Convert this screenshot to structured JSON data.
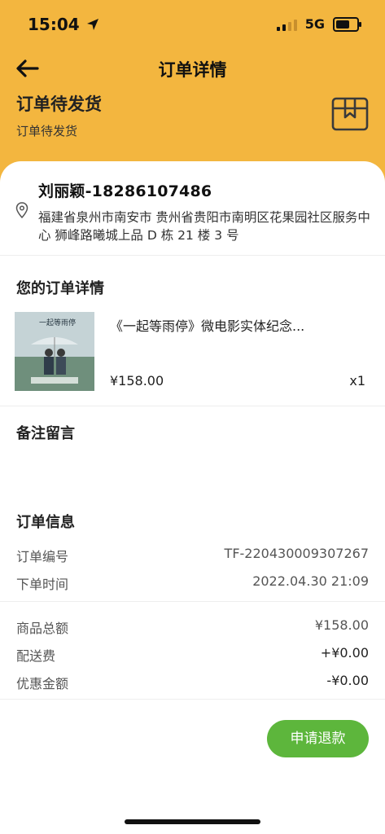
{
  "status_bar": {
    "time": "15:04",
    "network": "5G"
  },
  "header": {
    "title": "订单详情",
    "status_title": "订单待发货",
    "status_subtitle": "订单待发货"
  },
  "address": {
    "name_phone": "刘丽颖-18286107486",
    "detail": "福建省泉州市南安市 贵州省贵阳市南明区花果园社区服务中心 狮峰路曦城上品 D 栋 21 楼 3 号"
  },
  "order_items": {
    "title": "您的订单详情",
    "items": [
      {
        "name": "《一起等雨停》微电影实体纪念...",
        "price": "¥158.00",
        "quantity": "x1"
      }
    ]
  },
  "remark": {
    "title": "备注留言"
  },
  "order_info": {
    "title": "订单信息",
    "order_no_label": "订单编号",
    "order_no": "TF-220430009307267",
    "order_time_label": "下单时间",
    "order_time": "2022.04.30 21:09"
  },
  "amounts": {
    "goods_total_label": "商品总额",
    "goods_total": "¥158.00",
    "shipping_label": "配送费",
    "shipping": "+¥0.00",
    "discount_label": "优惠金额",
    "discount": "-¥0.00"
  },
  "actions": {
    "refund_label": "申请退款"
  },
  "colors": {
    "header_bg": "#f3b63f",
    "refund_button": "#5db63c"
  }
}
